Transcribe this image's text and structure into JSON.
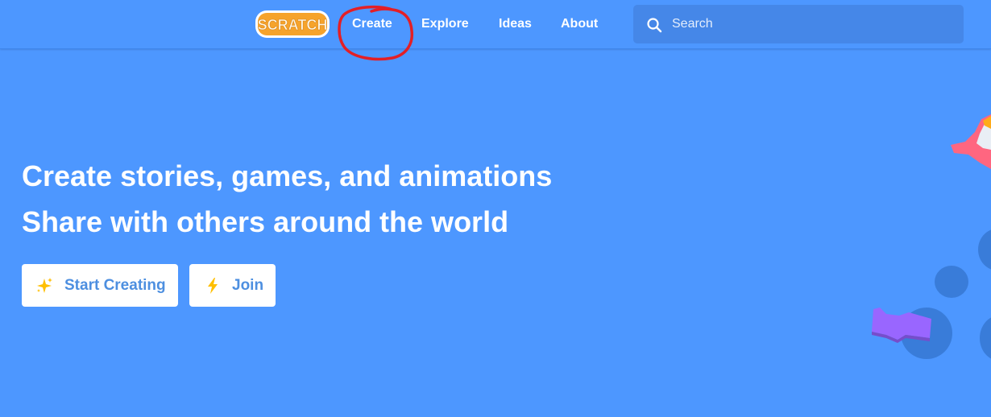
{
  "nav": {
    "logo": "SCRATCH",
    "links": [
      {
        "label": "Create"
      },
      {
        "label": "Explore"
      },
      {
        "label": "Ideas"
      },
      {
        "label": "About"
      }
    ],
    "search": {
      "placeholder": "Search",
      "value": "",
      "icon": "search-icon"
    }
  },
  "hero": {
    "line1": "Create stories, games, and animations",
    "line2": "Share with others around the world",
    "buttons": [
      {
        "label": "Start Creating",
        "icon": "sparkle-icon"
      },
      {
        "label": "Join",
        "icon": "lightning-icon"
      }
    ]
  },
  "colors": {
    "background": "#4d97ff",
    "search_bg": "#4587e8",
    "button_text": "#4d8fe0",
    "annotation": "#e31f26",
    "logo_orange": "#f6a32b",
    "accent_yellow": "#ffbf00"
  }
}
